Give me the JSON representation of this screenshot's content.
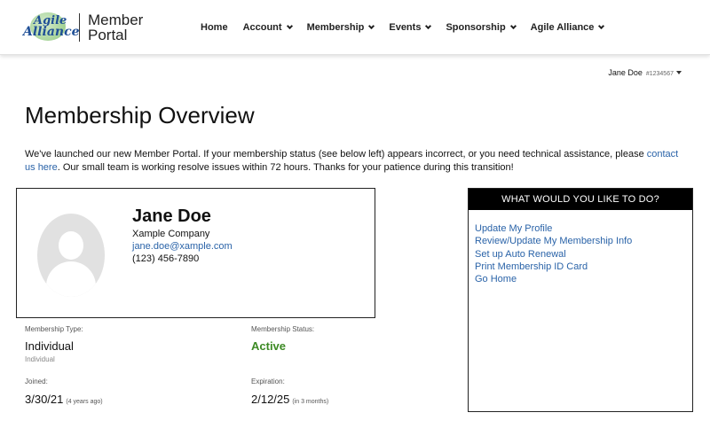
{
  "header": {
    "logo_line1": "Agile",
    "logo_line2": "Alliance",
    "portal_line1": "Member",
    "portal_line2": "Portal",
    "nav": [
      {
        "label": "Home",
        "dropdown": false
      },
      {
        "label": "Account",
        "dropdown": true
      },
      {
        "label": "Membership",
        "dropdown": true
      },
      {
        "label": "Events",
        "dropdown": true
      },
      {
        "label": "Sponsorship",
        "dropdown": true
      },
      {
        "label": "Agile Alliance",
        "dropdown": true
      }
    ]
  },
  "user": {
    "name": "Jane Doe",
    "id": "#1234567"
  },
  "page": {
    "title": "Membership Overview",
    "notice_before": "We've launched our new Member Portal. If your membership status (see below left) appears incorrect, or you need technical assistance, please ",
    "notice_link1": "contact us",
    "notice_link2": "here",
    "notice_after": ". Our small team is working resolve issues within 72 hours. Thanks for your patience during this transition!"
  },
  "profile": {
    "name": "Jane Doe",
    "company": "Xample Company",
    "email": "jane.doe@xample.com",
    "phone": "(123) 456-7890"
  },
  "membership": {
    "type_label": "Membership Type:",
    "type_value": "Individual",
    "type_sub": "Individual",
    "status_label": "Membership Status:",
    "status_value": "Active",
    "joined_label": "Joined:",
    "joined_value": "3/30/21",
    "joined_note": "(4 years ago)",
    "expiration_label": "Expiration:",
    "expiration_value": "2/12/25",
    "expiration_note": "(in 3 months)"
  },
  "actions": {
    "heading": "WHAT WOULD YOU LIKE TO DO?",
    "links": [
      "Update My Profile",
      "Review/Update My Membership Info",
      "Set up Auto Renewal",
      "Print Membership ID Card",
      "Go Home"
    ]
  },
  "colors": {
    "link": "#2a63a8",
    "active_status": "#3c8a24",
    "actions_header_bg": "#000000"
  }
}
